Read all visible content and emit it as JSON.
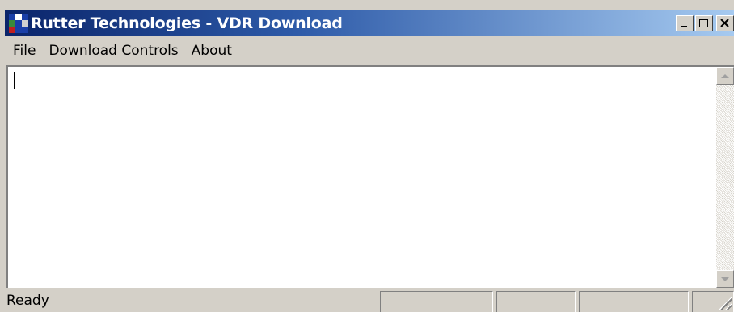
{
  "window": {
    "title": "Rutter Technologies - VDR Download",
    "buttons": [
      "minimize",
      "maximize",
      "close"
    ],
    "icon": "app-icon",
    "colors": {
      "titlebar_start": "#0a246a",
      "titlebar_end": "#a6caf0",
      "chrome": "#d4d0c8"
    }
  },
  "menu": {
    "items": [
      "File",
      "Download Controls",
      "About"
    ]
  },
  "content": {
    "text": ""
  },
  "status": {
    "text": "Ready",
    "panels": [
      "",
      "",
      "",
      ""
    ]
  }
}
